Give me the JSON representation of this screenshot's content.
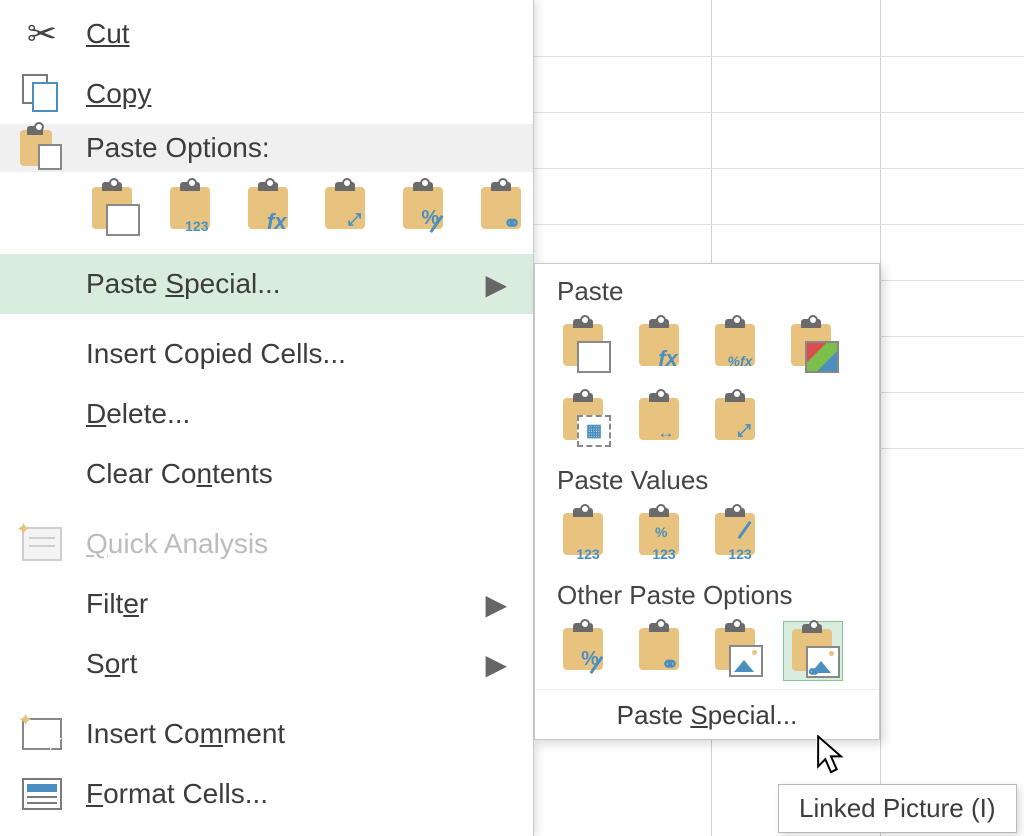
{
  "context_menu": {
    "cut": "Cut",
    "copy": "Copy",
    "paste_options_header": "Paste Options:",
    "paste_special": "Paste Special...",
    "insert_copied": "Insert Copied Cells...",
    "delete": "Delete...",
    "clear_contents": "Clear Contents",
    "quick_analysis": "Quick Analysis",
    "filter": "Filter",
    "sort": "Sort",
    "insert_comment": "Insert Comment",
    "format_cells": "Format Cells..."
  },
  "paste_option_icons": {
    "paste": "",
    "values": "123",
    "formulas": "fx",
    "transpose": "⤢",
    "formatting": "%",
    "link": "⚭"
  },
  "submenu": {
    "paste_header": "Paste",
    "paste_values_header": "Paste Values",
    "other_header": "Other Paste Options",
    "paste_special_footer": "Paste Special...",
    "icons": {
      "r1": [
        "",
        "fx",
        "%fx",
        ""
      ],
      "r2": [
        "▦",
        "↔",
        "⤢"
      ],
      "values": [
        "123",
        "123",
        "123"
      ],
      "values_sub": [
        "",
        "%",
        ""
      ],
      "other": [
        "%",
        "⚭",
        "",
        "⚭"
      ]
    }
  },
  "tooltip": "Linked Picture (I)"
}
